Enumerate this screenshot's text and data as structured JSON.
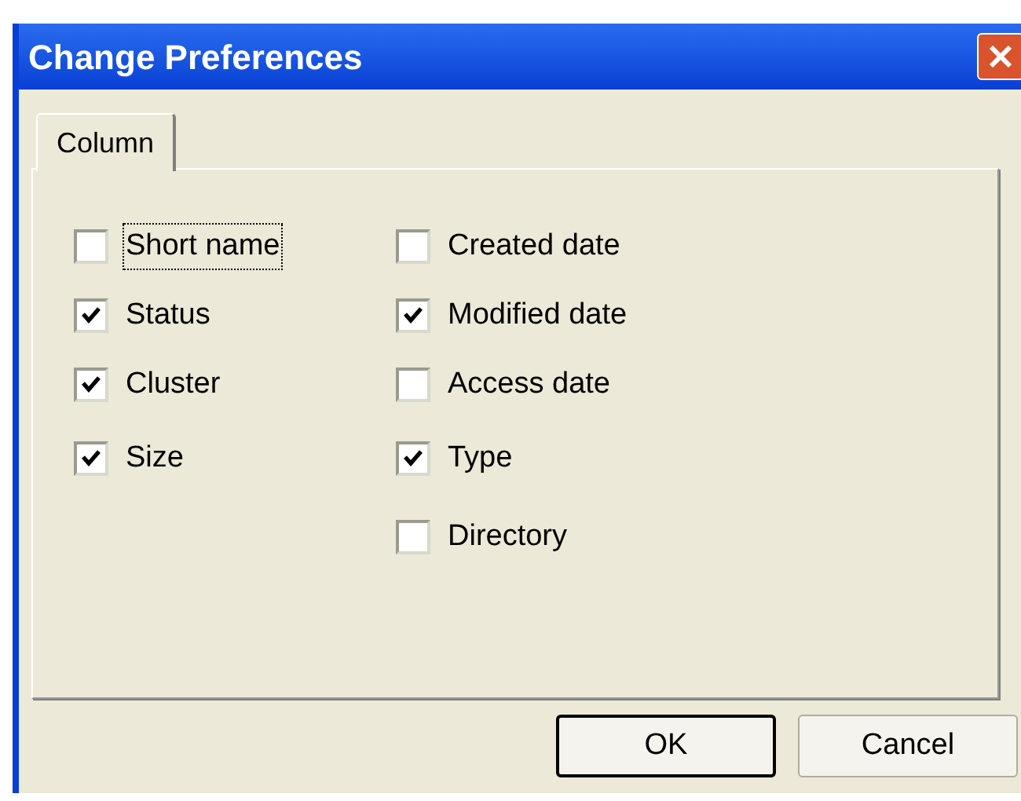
{
  "window": {
    "title": "Change Preferences"
  },
  "tabs": [
    {
      "label": "Column",
      "selected": true
    }
  ],
  "columns": [
    [
      {
        "label": "Short name",
        "checked": false,
        "focused": true
      },
      {
        "label": "Status",
        "checked": true,
        "focused": false
      },
      {
        "label": "Cluster",
        "checked": true,
        "focused": false
      },
      {
        "label": "Size",
        "checked": true,
        "focused": false
      }
    ],
    [
      {
        "label": "Created date",
        "checked": false,
        "focused": false
      },
      {
        "label": "Modified date",
        "checked": true,
        "focused": false
      },
      {
        "label": "Access date",
        "checked": false,
        "focused": false
      },
      {
        "label": "Type",
        "checked": true,
        "focused": false
      },
      {
        "label": "Directory",
        "checked": false,
        "focused": false
      }
    ]
  ],
  "buttons": [
    {
      "label": "OK",
      "default": true
    },
    {
      "label": "Cancel",
      "default": false
    }
  ]
}
